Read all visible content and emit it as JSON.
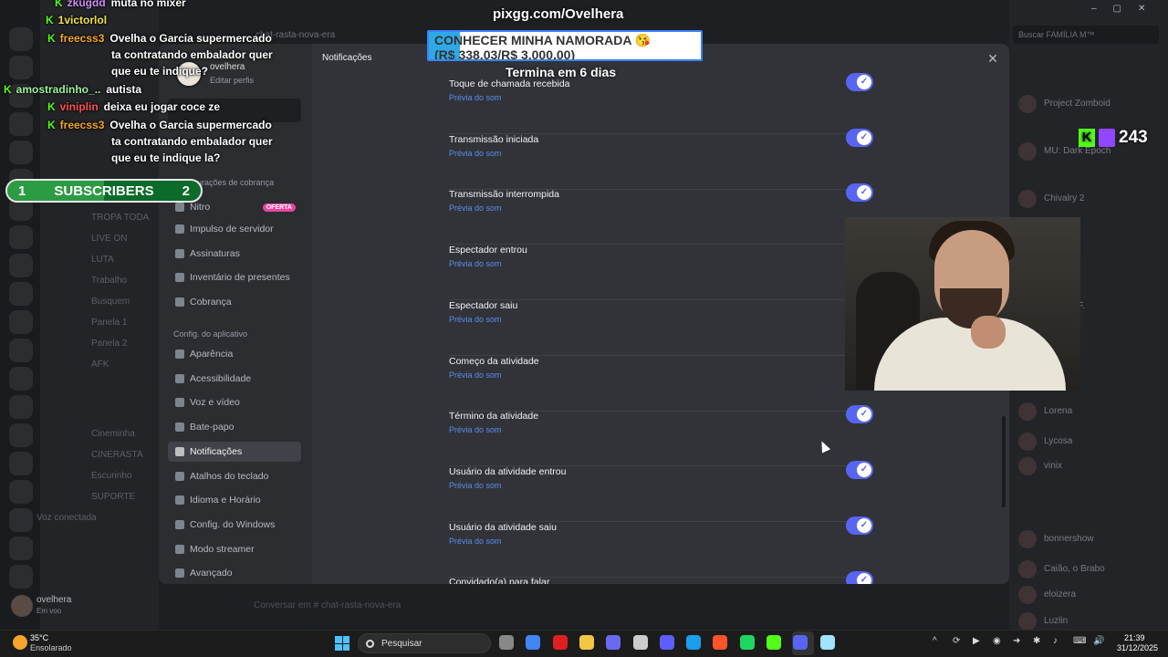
{
  "background": {
    "topbar_channel": "chat-rasta-nova-era",
    "search_placeholder": "Buscar FAMÍLIA M™",
    "composer_placeholder": "Conversar em # chat-rasta-nova-era",
    "user_name": "ovelhera",
    "user_status": "Em voo",
    "channels": [
      "TROPA TODA",
      "LIVE ON",
      "LUTA",
      "Trabalho",
      "Busquem",
      "Panela 1",
      "Panela 2",
      "AFK",
      "Cineminha",
      "CINERASTA",
      "Escurinho",
      "SUPORTE",
      "Voz conectada"
    ],
    "members": [
      "Project Zomboid",
      "MU: Dark Epoch",
      "Chivalry 2",
      "ovelhera",
      ".TSHURF.",
      "Lorena",
      "Lycosa",
      "vinix",
      "bonnershow",
      "Caião, o Brabo",
      "eloizera",
      "Luzlin"
    ]
  },
  "settings": {
    "content_title": "Notificações",
    "profile_name": "ovelhera",
    "profile_edit": "Editar perfis",
    "billing_section": "Configurações de cobrança",
    "app_section": "Config. do aplicativo",
    "nitro_badge": "OFERTA",
    "sidebar_billing": [
      "Nitro",
      "Impulso de servidor",
      "Assinaturas",
      "Inventário de presentes",
      "Cobrança"
    ],
    "sidebar_app": [
      "Aparência",
      "Acessibilidade",
      "Voz e vídeo",
      "Bate-papo",
      "Notificações",
      "Atalhos do teclado",
      "Idioma e Horário",
      "Config. do Windows",
      "Modo streamer",
      "Avançado"
    ],
    "preview_label": "Prévia do som",
    "sounds": [
      {
        "title": "Toque de chamada recebida",
        "enabled": true
      },
      {
        "title": "Transmissão iniciada",
        "enabled": true
      },
      {
        "title": "Transmissão interrompida",
        "enabled": true
      },
      {
        "title": "Espectador entrou",
        "enabled": true
      },
      {
        "title": "Espectador saiu",
        "enabled": true
      },
      {
        "title": "Começo da atividade",
        "enabled": false
      },
      {
        "title": "Término da atividade",
        "enabled": true
      },
      {
        "title": "Usuário da atividade entrou",
        "enabled": true
      },
      {
        "title": "Usuário da atividade saiu",
        "enabled": true
      },
      {
        "title": "Convidado(a) para falar",
        "enabled": true
      }
    ]
  },
  "overlay": {
    "chat": [
      {
        "user": "zkugdd",
        "color": "#ce8df6",
        "msg": "muta no mixer"
      },
      {
        "user": "1victorlol",
        "color": "#f0e24a",
        "msg": ""
      },
      {
        "user": "freecss3",
        "color": "#f5a623",
        "msg": "Ovelha o Garcia supermercado"
      },
      {
        "user": "",
        "color": "#fff",
        "msg": "ta contratando embalador quer"
      },
      {
        "user": "",
        "color": "#fff",
        "msg": "que eu te indique?"
      },
      {
        "user": "amostradinho_..",
        "color": "#9ef29e",
        "msg": "autista"
      },
      {
        "user": "viniplin",
        "color": "#ff5050",
        "msg": "deixa eu jogar coce ze"
      },
      {
        "user": "freecss3",
        "color": "#f5a623",
        "msg": "Ovelha o Garcia supermercado"
      },
      {
        "user": "",
        "color": "#fff",
        "msg": "ta contratando embalador quer"
      },
      {
        "user": "",
        "color": "#fff",
        "msg": "que eu te indique la?"
      }
    ],
    "sub_goal": {
      "current": "1",
      "label": "SUBSCRIBERS",
      "target": "2",
      "progress": 0.5
    },
    "donation_url": "pixgg.com/Ovelhera",
    "goal_title": "CONHECER MINHA NAMORADA 😘",
    "goal_amount": "(R$ 338,03/R$ 3.000,00)",
    "goal_progress": 0.113,
    "goal_ends": "Termina em 6 dias",
    "viewers": "243"
  },
  "taskbar": {
    "temp": "35°C",
    "condition": "Ensolarado",
    "search": "Pesquisar",
    "time": "21:39",
    "date": "31/12/2025"
  },
  "colors": {
    "accent": "#5865f2",
    "link": "#5b8def",
    "kick": "#53fc18",
    "twitch": "#9146ff"
  }
}
